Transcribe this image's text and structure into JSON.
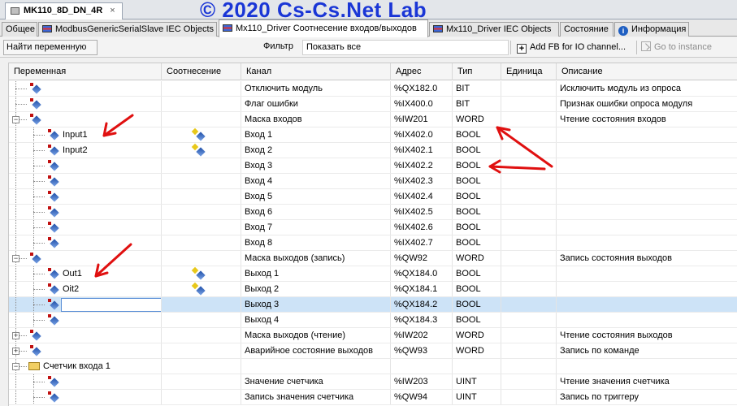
{
  "document_tab": {
    "title": "MK110_8D_DN_4R",
    "close": "×"
  },
  "watermark": "© 2020 Cs-Cs.Net Lab",
  "editor_tabs": [
    {
      "label": "Общее",
      "icon": ""
    },
    {
      "label": "ModbusGenericSerialSlave IEC Objects",
      "icon": "io-map-icon"
    },
    {
      "label": "Mx110_Driver Соотнесение входов/выходов",
      "icon": "io-map-icon"
    },
    {
      "label": "Mx110_Driver IEC Objects",
      "icon": "io-map-icon"
    },
    {
      "label": "Состояние",
      "icon": ""
    },
    {
      "label": "Информация",
      "icon": "info-icon"
    }
  ],
  "active_tab_index": 2,
  "toolbar": {
    "find_variable": "Найти переменную",
    "filter_label": "Фильтр",
    "filter_value": "Показать все",
    "add_fb": "Add FB for IO channel...",
    "go_to_instance": "Go to instance"
  },
  "columns": {
    "variable": "Переменная",
    "mapping": "Соотнесение",
    "channel": "Канал",
    "address": "Адрес",
    "type": "Тип",
    "unit": "Единица",
    "description": "Описание"
  },
  "rows": [
    {
      "level": 1,
      "expander": "",
      "kind": "var",
      "variable": "",
      "mapped": false,
      "channel": "Отключить модуль",
      "address": "%QX182.0",
      "type": "BIT",
      "unit": "",
      "description": "Исключить модуль из опроса"
    },
    {
      "level": 1,
      "expander": "",
      "kind": "var",
      "variable": "",
      "mapped": false,
      "channel": "Флаг ошибки",
      "address": "%IX400.0",
      "type": "BIT",
      "unit": "",
      "description": "Признак ошибки опроса модуля"
    },
    {
      "level": 1,
      "expander": "−",
      "kind": "var",
      "variable": "",
      "mapped": false,
      "channel": "Маска входов",
      "address": "%IW201",
      "type": "WORD",
      "unit": "",
      "description": "Чтение состояния входов"
    },
    {
      "level": 2,
      "expander": "",
      "kind": "var",
      "variable": "Input1",
      "mapped": true,
      "channel": "Вход 1",
      "address": "%IX402.0",
      "type": "BOOL",
      "unit": "",
      "description": ""
    },
    {
      "level": 2,
      "expander": "",
      "kind": "var",
      "variable": "Input2",
      "mapped": true,
      "channel": "Вход 2",
      "address": "%IX402.1",
      "type": "BOOL",
      "unit": "",
      "description": ""
    },
    {
      "level": 2,
      "expander": "",
      "kind": "var",
      "variable": "",
      "mapped": false,
      "channel": "Вход 3",
      "address": "%IX402.2",
      "type": "BOOL",
      "unit": "",
      "description": ""
    },
    {
      "level": 2,
      "expander": "",
      "kind": "var",
      "variable": "",
      "mapped": false,
      "channel": "Вход 4",
      "address": "%IX402.3",
      "type": "BOOL",
      "unit": "",
      "description": ""
    },
    {
      "level": 2,
      "expander": "",
      "kind": "var",
      "variable": "",
      "mapped": false,
      "channel": "Вход 5",
      "address": "%IX402.4",
      "type": "BOOL",
      "unit": "",
      "description": ""
    },
    {
      "level": 2,
      "expander": "",
      "kind": "var",
      "variable": "",
      "mapped": false,
      "channel": "Вход 6",
      "address": "%IX402.5",
      "type": "BOOL",
      "unit": "",
      "description": ""
    },
    {
      "level": 2,
      "expander": "",
      "kind": "var",
      "variable": "",
      "mapped": false,
      "channel": "Вход 7",
      "address": "%IX402.6",
      "type": "BOOL",
      "unit": "",
      "description": ""
    },
    {
      "level": 2,
      "expander": "",
      "kind": "var",
      "variable": "",
      "mapped": false,
      "channel": "Вход 8",
      "address": "%IX402.7",
      "type": "BOOL",
      "unit": "",
      "description": ""
    },
    {
      "level": 1,
      "expander": "−",
      "kind": "var",
      "variable": "",
      "mapped": false,
      "channel": "Маска выходов (запись)",
      "address": "%QW92",
      "type": "WORD",
      "unit": "",
      "description": "Запись состояния выходов"
    },
    {
      "level": 2,
      "expander": "",
      "kind": "var",
      "variable": "Out1",
      "mapped": true,
      "channel": "Выход 1",
      "address": "%QX184.0",
      "type": "BOOL",
      "unit": "",
      "description": ""
    },
    {
      "level": 2,
      "expander": "",
      "kind": "var",
      "variable": "Oit2",
      "mapped": true,
      "channel": "Выход 2",
      "address": "%QX184.1",
      "type": "BOOL",
      "unit": "",
      "description": ""
    },
    {
      "level": 2,
      "expander": "",
      "kind": "var",
      "variable": "",
      "mapped": false,
      "editing": true,
      "selected": true,
      "channel": "Выход 3",
      "address": "%QX184.2",
      "type": "BOOL",
      "unit": "",
      "description": ""
    },
    {
      "level": 2,
      "expander": "",
      "kind": "var",
      "variable": "",
      "mapped": false,
      "channel": "Выход 4",
      "address": "%QX184.3",
      "type": "BOOL",
      "unit": "",
      "description": ""
    },
    {
      "level": 1,
      "expander": "+",
      "kind": "var",
      "variable": "",
      "mapped": false,
      "channel": "Маска выходов (чтение)",
      "address": "%IW202",
      "type": "WORD",
      "unit": "",
      "description": "Чтение состояния выходов"
    },
    {
      "level": 1,
      "expander": "+",
      "kind": "var",
      "variable": "",
      "mapped": false,
      "channel": "Аварийное состояние выходов",
      "address": "%QW93",
      "type": "WORD",
      "unit": "",
      "description": "Запись по команде"
    },
    {
      "level": 1,
      "expander": "−",
      "kind": "folder",
      "variable": "Счетчик входа 1",
      "mapped": false,
      "channel": "",
      "address": "",
      "type": "",
      "unit": "",
      "description": ""
    },
    {
      "level": 2,
      "expander": "",
      "kind": "var",
      "variable": "",
      "mapped": false,
      "channel": "Значение счетчика",
      "address": "%IW203",
      "type": "UINT",
      "unit": "",
      "description": "Чтение значения счетчика"
    },
    {
      "level": 2,
      "expander": "",
      "kind": "var",
      "variable": "",
      "mapped": false,
      "channel": "Запись значения счетчика",
      "address": "%QW94",
      "type": "UINT",
      "unit": "",
      "description": "Запись по триггеру"
    }
  ],
  "colors": {
    "watermark": "#1a36d6",
    "annotation_arrow": "#e01010",
    "selected_row": "#cde3f7"
  }
}
